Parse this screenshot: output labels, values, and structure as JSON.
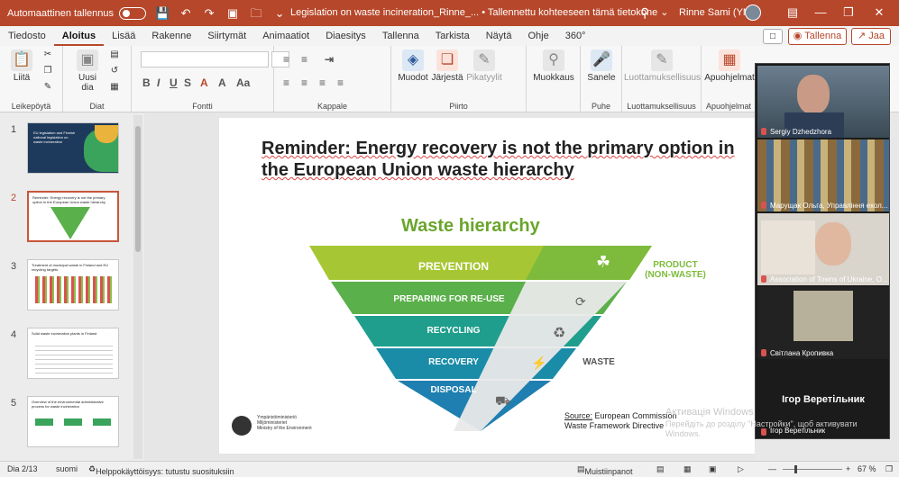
{
  "titlebar": {
    "autosave_label": "Automaattinen tallennus",
    "doc_title": "Legislation on waste incineration_Rinne_... • Tallennettu kohteeseen tämä tietokone ⌄",
    "user_name": "Rinne Sami (YM)"
  },
  "tabs": [
    "Tiedosto",
    "Aloitus",
    "Lisää",
    "Rakenne",
    "Siirtymät",
    "Animaatiot",
    "Diaesitys",
    "Tallenna",
    "Tarkista",
    "Näytä",
    "Ohje",
    "360°"
  ],
  "active_tab": "Aloitus",
  "actions": {
    "record": "Tallenna",
    "share": "Jaa"
  },
  "ribbon": {
    "paste": "Liitä",
    "new_slide": "Uusi dia",
    "shapes": "Muodot",
    "arrange": "Järjestä",
    "quick_styles": "Pikatyylit",
    "editing": "Muokkaus",
    "dictate": "Sanele",
    "sensitivity": "Luottamuksellisuus",
    "designer": "Apuohjelmat",
    "groups": [
      "Leikepöytä",
      "Diat",
      "Fontti",
      "Kappale",
      "Piirto",
      "Puhe",
      "Luottamuksellisuus",
      "Apuohjelmat"
    ]
  },
  "thumbnails": [
    {
      "num": "1",
      "text": "EU legislation and Finnish national legislation on waste incineration"
    },
    {
      "num": "2",
      "text": "Reminder: Energy recovery is not the primary option in the European Union waste hierarchy"
    },
    {
      "num": "3",
      "text": "Treatment of municipal waste in Finland and EU recycling targets"
    },
    {
      "num": "4",
      "text": "Solid waste incineration plants in Finland"
    },
    {
      "num": "5",
      "text": "Overview of the environmental administrative process for waste incineration"
    }
  ],
  "slide": {
    "title_line1": "Reminder: Energy recovery is not the primary option in",
    "title_line2": "the European Union waste hierarchy",
    "hierarchy_title": "Waste hierarchy",
    "levels": [
      "PREVENTION",
      "PREPARING FOR RE-USE",
      "RECYCLING",
      "RECOVERY",
      "DISPOSAL"
    ],
    "product_label": "PRODUCT",
    "product_sub": "(NON-WASTE)",
    "waste_label": "WASTE",
    "source_label": "Source:",
    "source_org": "European Commission",
    "source_doc": "Waste Framework Directive",
    "ministry_line1": "Ympäristöministeriö",
    "ministry_line2": "Miljöministeriet",
    "ministry_line3": "Ministry of the Environment"
  },
  "participants": [
    {
      "name": "Sergiy Dzhedzhora"
    },
    {
      "name": "Марущак Ольга, Управління екол..."
    },
    {
      "name": "Association of Towns of Ukraine, O..."
    },
    {
      "name": "Світлана Кропивка"
    }
  ],
  "speaker": {
    "name": "Ігор Веретільник",
    "sub": "Ігор Веретільник"
  },
  "watermark": {
    "title": "Активація Windows",
    "sub": "Перейдіть до розділу \"Настройки\", щоб активувати Windows."
  },
  "status": {
    "slide_pos": "Dia 2/13",
    "language": "suomi",
    "accessibility": "Helppokäyttöisyys: tutustu suosituksiin",
    "notes": "Muistiinpanot",
    "zoom": "67 %"
  },
  "colors": {
    "brand": "#b7472a",
    "green1": "#a6c733",
    "green2": "#5ab04a",
    "teal1": "#1f9e8d",
    "teal2": "#1a8ca8",
    "blue": "#1e7fb0"
  }
}
